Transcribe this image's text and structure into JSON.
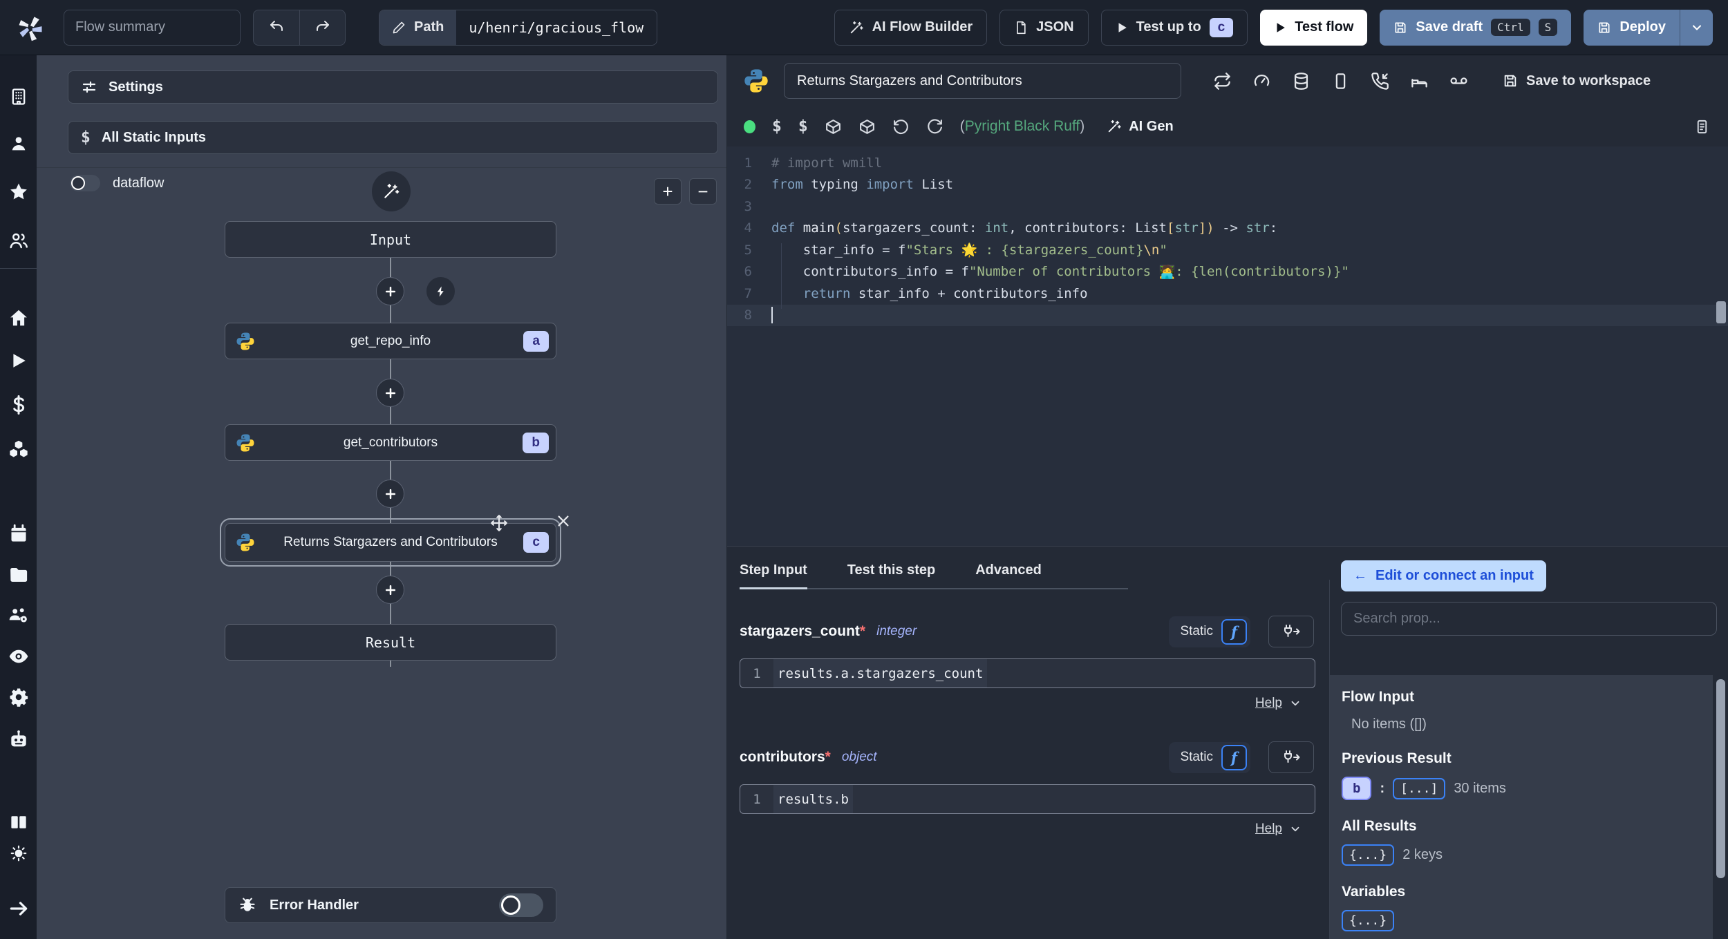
{
  "topbar": {
    "flow_summary_placeholder": "Flow summary",
    "path_label": "Path",
    "path_value": "u/henri/gracious_flow",
    "ai_flow_builder": "AI Flow Builder",
    "json_label": "JSON",
    "test_up_to": "Test up to",
    "test_up_to_step": "c",
    "test_flow": "Test flow",
    "save_draft": "Save draft",
    "kbd": [
      "Ctrl",
      "S"
    ],
    "deploy": "Deploy"
  },
  "flow_panel": {
    "settings_label": "Settings",
    "static_inputs_label": "All Static Inputs",
    "dataflow_label": "dataflow",
    "zoom_in": "+",
    "zoom_out": "−",
    "nodes": {
      "input": "Input",
      "a": {
        "label": "get_repo_info",
        "badge": "a"
      },
      "b": {
        "label": "get_contributors",
        "badge": "b"
      },
      "c": {
        "label": "Returns Stargazers and Contributors",
        "badge": "c"
      },
      "result": "Result"
    },
    "error_handler_label": "Error Handler"
  },
  "editor": {
    "title": "Returns Stargazers and Contributors",
    "save_to_workspace": "Save to workspace",
    "lint_open": "(",
    "lint_assistants": "Pyright Black Ruff",
    "lint_close": ")",
    "ai_gen_label": "AI Gen",
    "code": [
      [
        [
          "c",
          "# import wmill"
        ]
      ],
      [
        [
          "k",
          "from"
        ],
        [
          "v",
          " typing "
        ],
        [
          "k",
          "import"
        ],
        [
          "v",
          " List"
        ]
      ],
      [],
      [
        [
          "k",
          "def"
        ],
        [
          "fn",
          " main"
        ],
        [
          "br",
          "("
        ],
        [
          "v",
          "stargazers_count: "
        ],
        [
          "t",
          "int"
        ],
        [
          "v",
          ", contributors: List"
        ],
        [
          "br",
          "["
        ],
        [
          "t",
          "str"
        ],
        [
          "br",
          "])"
        ],
        [
          "v",
          " -> "
        ],
        [
          "t",
          "str"
        ],
        [
          "v",
          ":"
        ]
      ],
      [
        [
          "v",
          "    star_info = f"
        ],
        [
          "s",
          "\"Stars "
        ],
        [
          "e",
          "🌟"
        ],
        [
          "s",
          " : {stargazers_count}"
        ],
        [
          "esc",
          "\\n"
        ],
        [
          "s",
          "\""
        ]
      ],
      [
        [
          "v",
          "    contributors_info = f"
        ],
        [
          "s",
          "\"Number of contributors "
        ],
        [
          "e",
          "🧑‍💻"
        ],
        [
          "s",
          ": {len(contributors)}\""
        ]
      ],
      [
        [
          "k",
          "    return"
        ],
        [
          "v",
          " star_info + contributors_info"
        ]
      ],
      []
    ]
  },
  "step_panel": {
    "tabs": [
      {
        "label": "Step Input"
      },
      {
        "label": "Test this step"
      },
      {
        "label": "Advanced"
      }
    ],
    "fields": [
      {
        "name": "stargazers_count",
        "required_mark": "*",
        "type": "integer",
        "mode": "Static",
        "fn_glyph": "f",
        "line_no": "1",
        "expr": "results.a.stargazers_count",
        "help_label": "Help"
      },
      {
        "name": "contributors",
        "required_mark": "*",
        "type": "object",
        "mode": "Static",
        "fn_glyph": "f",
        "line_no": "1",
        "expr": "results.b",
        "help_label": "Help"
      }
    ]
  },
  "connect_panel": {
    "back_arrow": "←",
    "back_label": "Edit or connect an input",
    "search_placeholder": "Search prop...",
    "flow_input_title": "Flow Input",
    "flow_input_empty": "No items ([])",
    "previous_result_title": "Previous Result",
    "previous_result_key": "b",
    "colon": ":",
    "previous_result_collapsed": "[...]",
    "previous_result_meta": "30 items",
    "all_results_title": "All Results",
    "all_results_collapsed": "{...}",
    "all_results_meta": "2 keys",
    "variables_title": "Variables",
    "variables_collapsed": "{...}"
  },
  "colors": {
    "accent_blue": "#3b82f6",
    "step_badge_bg": "#c7d2fe",
    "step_badge_text": "#312e81",
    "primary_button": "#5e7ca6",
    "lint_green": "#55a87d",
    "success_dot": "#4ade80"
  }
}
